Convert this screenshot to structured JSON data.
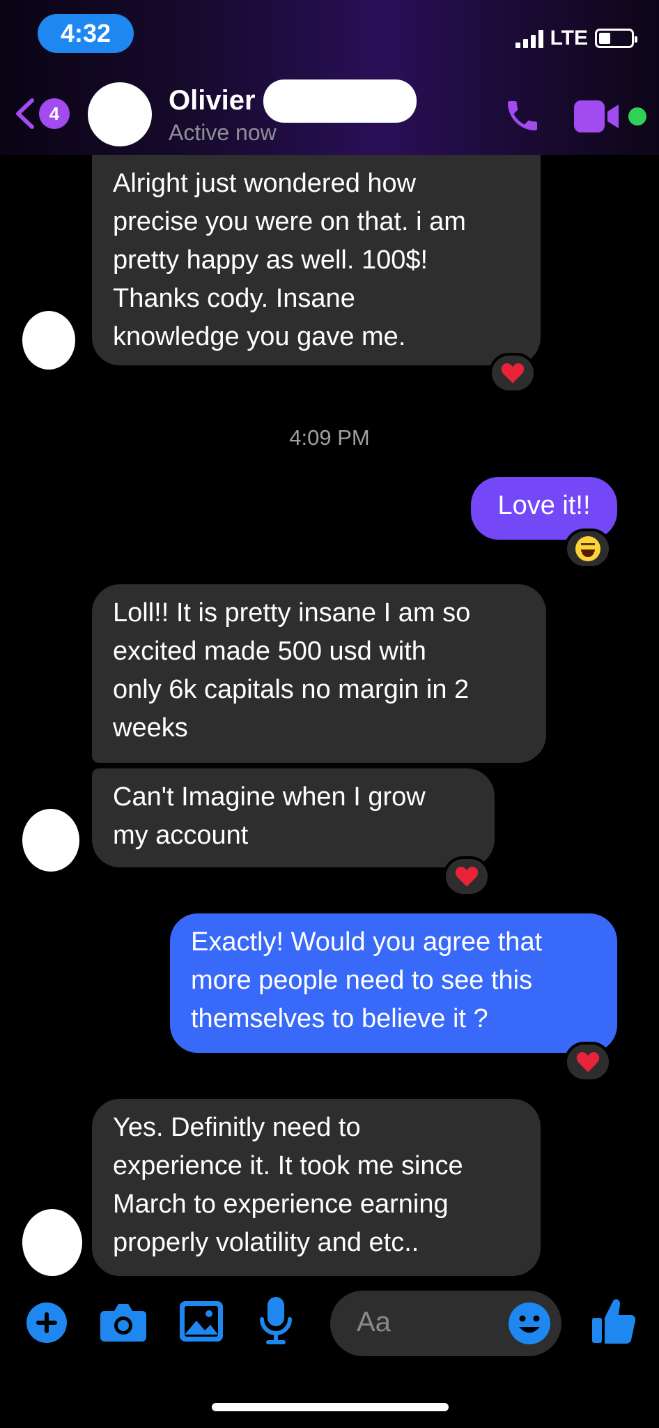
{
  "status_bar": {
    "time": "4:32",
    "network": "LTE"
  },
  "header": {
    "back_badge": "4",
    "contact_name": "Olivier",
    "status": "Active now"
  },
  "messages": [
    {
      "direction": "in",
      "text": "Alright just wondered how\nprecise you were on that. i am\npretty happy as well. 100$!\nThanks cody. Insane\nknowledge you gave me.",
      "reaction": "heart"
    },
    {
      "direction": "out",
      "text": "Love it!!",
      "reaction": "laughing"
    },
    {
      "direction": "in",
      "text": "Loll!! It is pretty insane I am so\nexcited made 500 usd with\nonly 6k capitals no margin in 2\nweeks"
    },
    {
      "direction": "in",
      "text": "Can't Imagine when I grow\nmy account",
      "reaction": "heart"
    },
    {
      "direction": "out",
      "text": "Exactly! Would you agree that\nmore people need to see this\nthemselves to believe it ?",
      "reaction": "heart"
    },
    {
      "direction": "in",
      "text": "Yes. Definitly need to\nexperience it. It took me since\nMarch to experience earning\nproperly volatility and etc.."
    }
  ],
  "timestamp": "4:09 PM",
  "composer": {
    "placeholder": "Aa",
    "icons": [
      "plus-icon",
      "camera-icon",
      "gallery-icon",
      "microphone-icon",
      "emoji-icon",
      "thumbs-up-icon"
    ]
  },
  "colors": {
    "accent_purple": "#a24cf0",
    "outgoing_purple": "#7448f6",
    "outgoing_blue": "#3969f8",
    "incoming": "#2e2e2e",
    "composer_blue": "#1e88f0",
    "online_green": "#31d158"
  }
}
